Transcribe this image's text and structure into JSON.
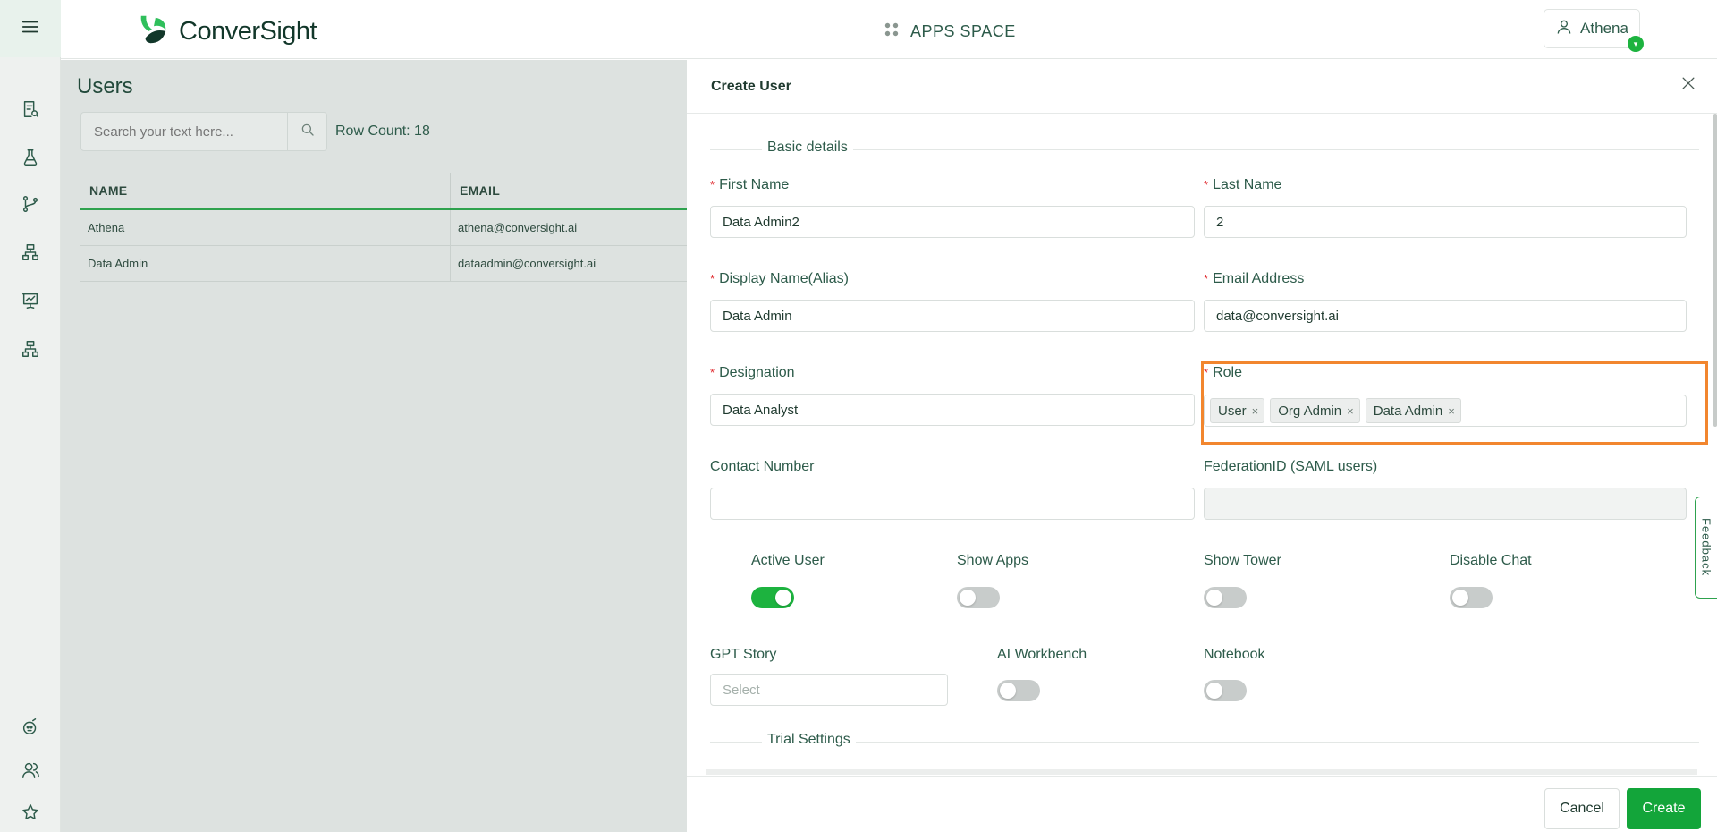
{
  "header": {
    "logo_text": "ConverSight",
    "apps_space_label": "APPS SPACE",
    "user_name": "Athena",
    "user_badge": "▾"
  },
  "sidebar": {
    "items": [
      {
        "icon": "report-search-icon"
      },
      {
        "icon": "flask-icon"
      },
      {
        "icon": "branch-icon"
      },
      {
        "icon": "hierarchy-icon"
      },
      {
        "icon": "presentation-chart-icon"
      },
      {
        "icon": "hierarchy-icon"
      }
    ],
    "bottom_items": [
      {
        "icon": "bot-icon"
      },
      {
        "icon": "users-icon"
      },
      {
        "icon": "star-icon"
      }
    ]
  },
  "users_page": {
    "title": "Users",
    "search_placeholder": "Search your text here...",
    "row_count": "Row Count: 18",
    "columns": [
      "NAME",
      "EMAIL"
    ],
    "rows": [
      {
        "name": "Athena",
        "email": "athena@conversight.ai"
      },
      {
        "name": "Data Admin",
        "email": "dataadmin@conversight.ai"
      }
    ]
  },
  "drawer": {
    "title": "Create User",
    "basic_details_label": "Basic details",
    "trial_settings_label": "Trial Settings",
    "fields": {
      "first_name": {
        "label": "First Name",
        "value": "Data Admin2"
      },
      "last_name": {
        "label": "Last Name",
        "value": "2"
      },
      "display_name": {
        "label": "Display Name(Alias)",
        "value": "Data Admin"
      },
      "email": {
        "label": "Email Address",
        "value": "data@conversight.ai"
      },
      "designation": {
        "label": "Designation",
        "value": "Data Analyst"
      },
      "role": {
        "label": "Role",
        "tags": [
          "User",
          "Org Admin",
          "Data Admin"
        ]
      },
      "contact_number": {
        "label": "Contact Number",
        "value": ""
      },
      "federation_id": {
        "label": "FederationID (SAML users)",
        "value": ""
      }
    },
    "toggles": {
      "active_user": {
        "label": "Active User",
        "on": true
      },
      "show_apps": {
        "label": "Show Apps",
        "on": false
      },
      "show_tower": {
        "label": "Show Tower",
        "on": false
      },
      "disable_chat": {
        "label": "Disable Chat",
        "on": false
      },
      "ai_workbench": {
        "label": "AI Workbench",
        "on": false
      },
      "notebook": {
        "label": "Notebook",
        "on": false
      }
    },
    "gpt_story": {
      "label": "GPT Story",
      "placeholder": "Select"
    },
    "cancel_label": "Cancel",
    "create_label": "Create",
    "required_mark": "*",
    "tag_remove": "×"
  },
  "feedback_label": "Feedback",
  "colors": {
    "accent_green": "#13a53a",
    "highlight_orange": "#f2862e",
    "required_red": "#e0282d"
  }
}
